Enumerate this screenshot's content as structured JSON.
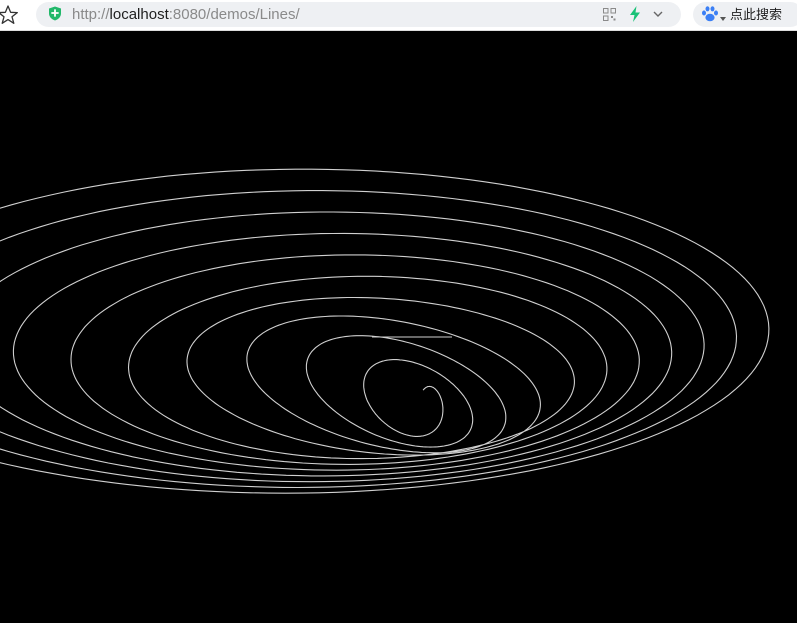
{
  "browser": {
    "url_prefix": "http://",
    "url_host": "localhost",
    "url_rest": ":8080/demos/Lines/",
    "search_label": "点此搜索"
  },
  "colors": {
    "background": "#000000",
    "line": "#d0d0d0",
    "toolbar": "#ffffff",
    "address_bar": "#eef0f3",
    "shield": "#21b86a",
    "bolt": "#19c277",
    "paw": "#3b7ff5"
  },
  "icons": [
    "star-icon",
    "shield-icon",
    "qr-icon",
    "bolt-icon",
    "chevron-down-icon",
    "paw-icon"
  ],
  "scene": {
    "type": "3d-spiral-lines",
    "turns": 11
  }
}
